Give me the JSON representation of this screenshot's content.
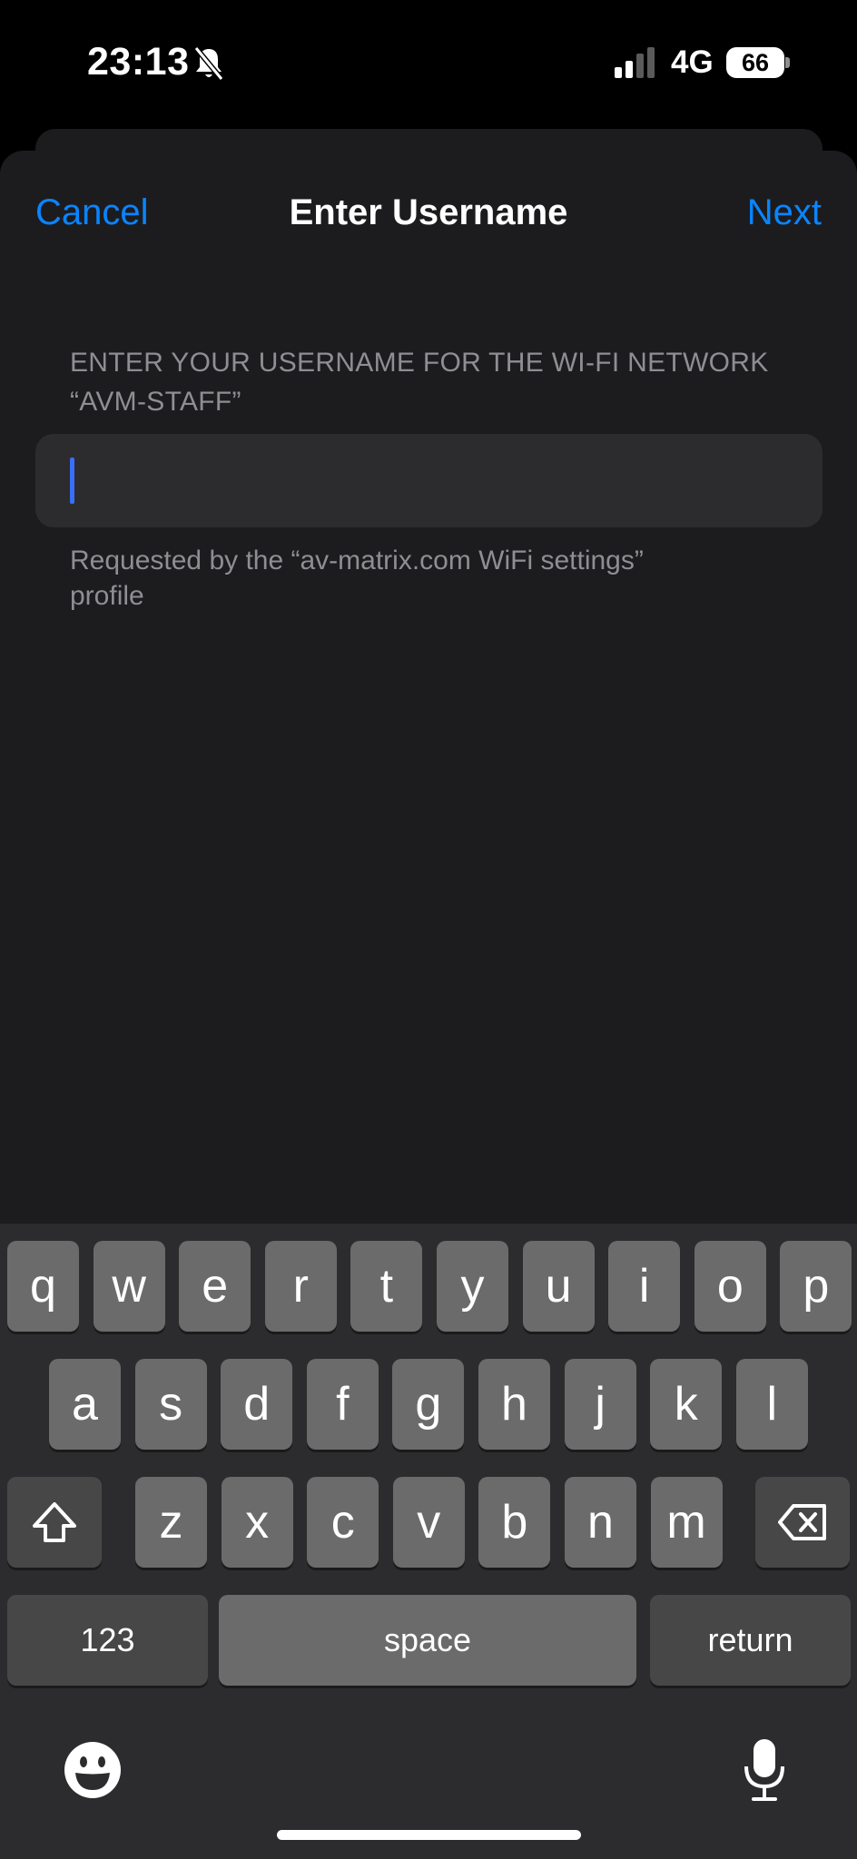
{
  "status_bar": {
    "time": "23:13",
    "network": "4G",
    "battery": "66"
  },
  "nav": {
    "cancel": "Cancel",
    "title": "Enter Username",
    "next": "Next"
  },
  "form": {
    "header": "ENTER YOUR USERNAME FOR THE WI-FI NETWORK “AVM-STAFF”",
    "username_value": "",
    "footer": "Requested by the “av-matrix.com WiFi settings” profile"
  },
  "keyboard": {
    "row1": [
      "q",
      "w",
      "e",
      "r",
      "t",
      "y",
      "u",
      "i",
      "o",
      "p"
    ],
    "row2": [
      "a",
      "s",
      "d",
      "f",
      "g",
      "h",
      "j",
      "k",
      "l"
    ],
    "row3": [
      "z",
      "x",
      "c",
      "v",
      "b",
      "n",
      "m"
    ],
    "numbers": "123",
    "space": "space",
    "return": "return"
  },
  "colors": {
    "accent": "#0a84ff",
    "caret": "#3a6ff7"
  }
}
